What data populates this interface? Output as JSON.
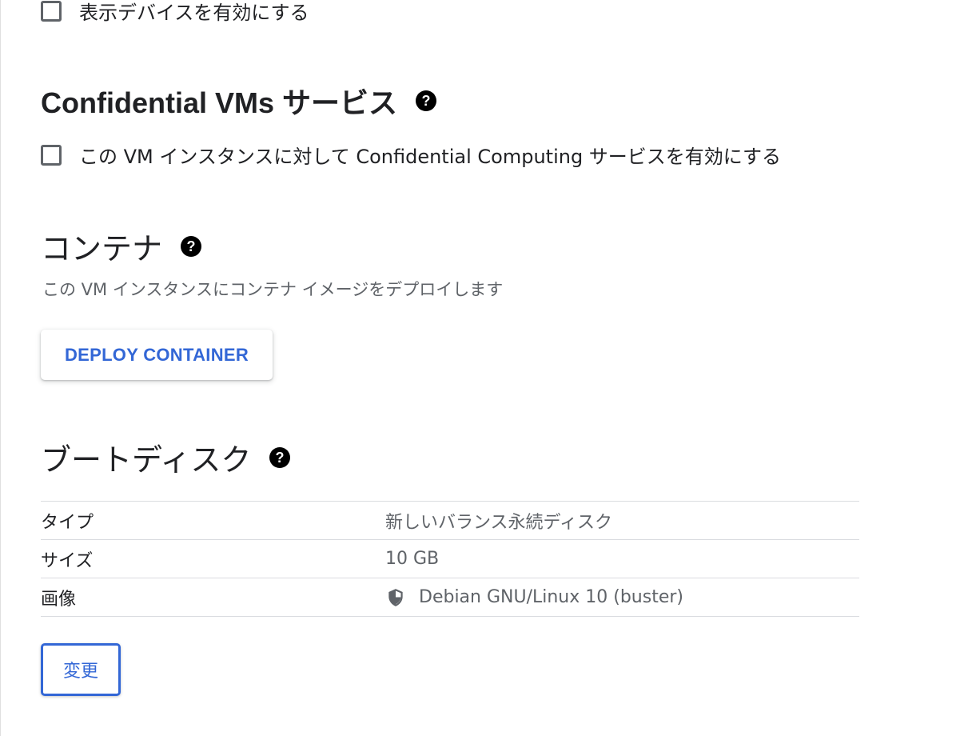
{
  "display_device": {
    "checkbox_label": "表示デバイスを有効にする",
    "checked": false
  },
  "confidential_vms": {
    "title": "Confidential VMs サービス",
    "help_icon": "help-circle-icon",
    "checkbox_label": "この VM インスタンスに対して Confidential Computing サービスを有効にする",
    "checked": false
  },
  "container": {
    "title": "コンテナ",
    "help_icon": "help-circle-icon",
    "description": "この VM インスタンスにコンテナ イメージをデプロイします",
    "deploy_button_label": "DEPLOY CONTAINER"
  },
  "boot_disk": {
    "title": "ブートディスク",
    "help_icon": "help-circle-icon",
    "rows": [
      {
        "key": "タイプ",
        "value": "新しいバランス永続ディスク"
      },
      {
        "key": "サイズ",
        "value": "10 GB"
      },
      {
        "key": "画像",
        "value": "Debian GNU/Linux 10 (buster)",
        "icon": "shield-icon"
      }
    ],
    "change_button_label": "変更"
  },
  "colors": {
    "accent": "#3367d6",
    "text": "#202124",
    "secondary_text": "#5f6368",
    "divider": "#dadce0"
  }
}
